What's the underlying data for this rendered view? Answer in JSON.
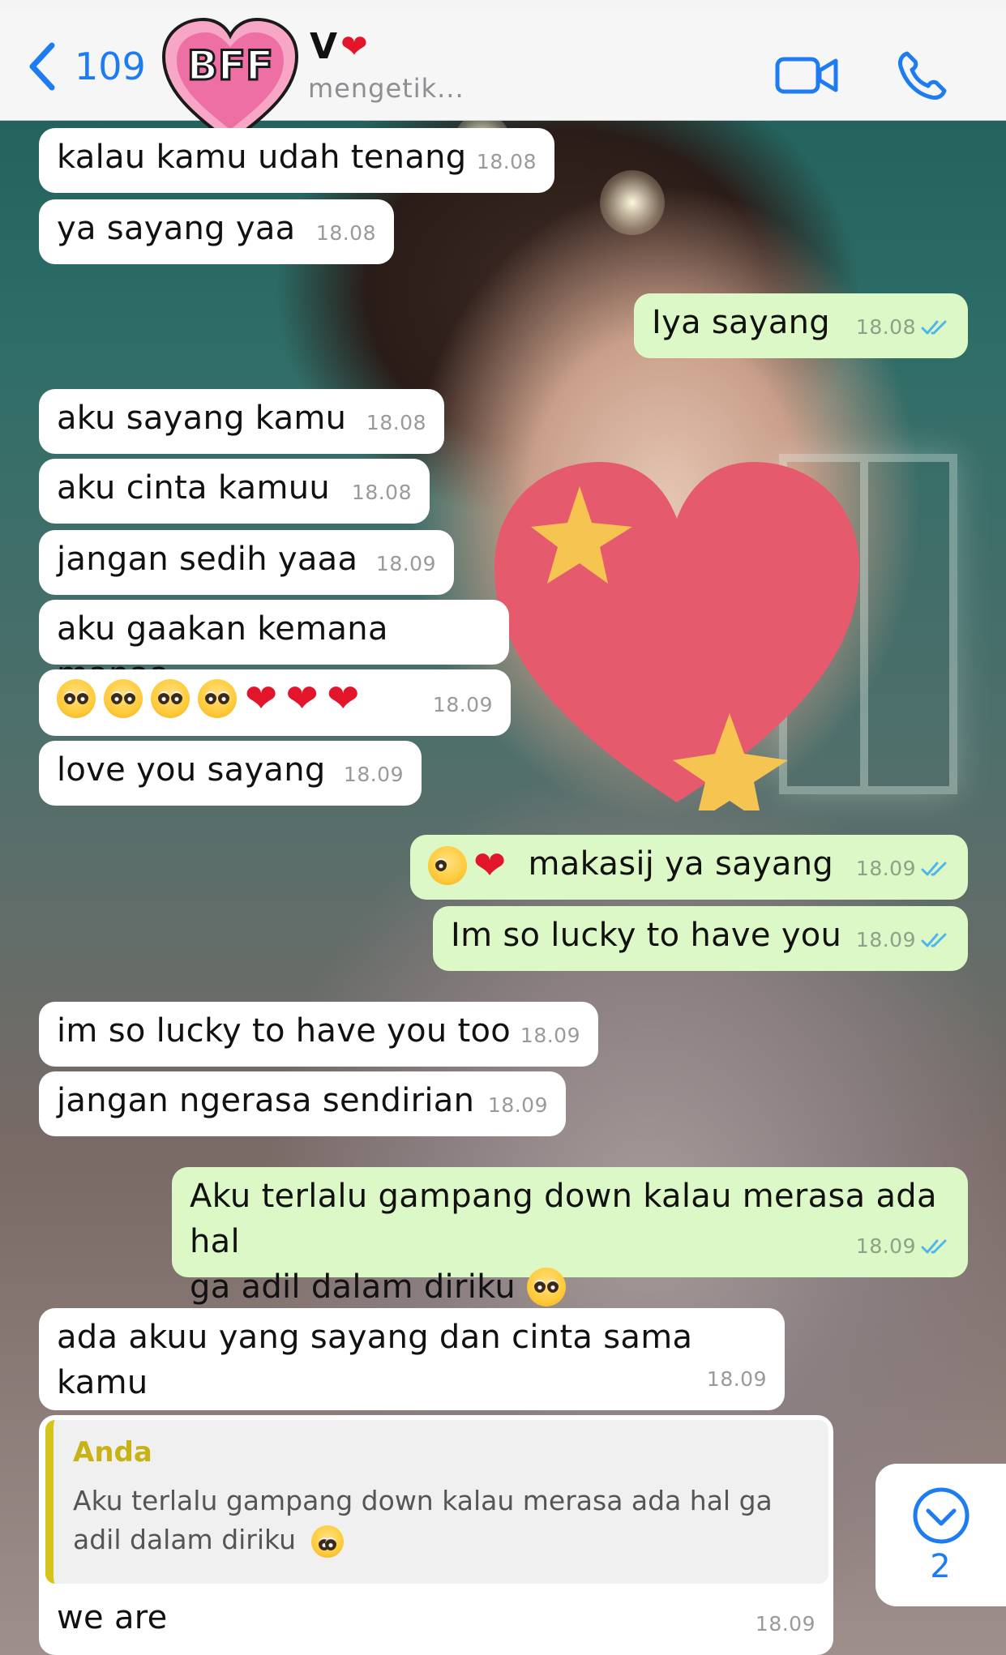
{
  "header": {
    "back_count": "109",
    "avatar_label": "BFF",
    "contact_name": "V",
    "status": "mengetik..."
  },
  "messages": [
    {
      "text": "kalau kamu udah tenang",
      "time": "18.08",
      "dir": "in"
    },
    {
      "text": "ya sayang yaa",
      "time": "18.08",
      "dir": "in"
    },
    {
      "text": "Iya sayang",
      "time": "18.08",
      "dir": "out"
    },
    {
      "text": "aku sayang kamu",
      "time": "18.08",
      "dir": "in"
    },
    {
      "text": "aku cinta kamuu",
      "time": "18.08",
      "dir": "in"
    },
    {
      "text": "jangan sedih yaaa",
      "time": "18.09",
      "dir": "in"
    },
    {
      "text": "aku gaakan kemana manaa",
      "time": "",
      "dir": "in"
    },
    {
      "text": "",
      "time": "18.09",
      "dir": "in"
    },
    {
      "text": "love you sayang",
      "time": "18.09",
      "dir": "in"
    },
    {
      "text": "makasij ya sayang",
      "time": "18.09",
      "dir": "out"
    },
    {
      "text": "Im so lucky to have you",
      "time": "18.09",
      "dir": "out"
    },
    {
      "text": "im so lucky to have you too",
      "time": "18.09",
      "dir": "in"
    },
    {
      "text": "jangan ngerasa sendirian",
      "time": "18.09",
      "dir": "in"
    },
    {
      "text_line1": "Aku terlalu gampang down kalau merasa ada hal",
      "text_line2": "ga adil dalam diriku",
      "time": "18.09",
      "dir": "out"
    },
    {
      "text": "ada akuu yang sayang dan cinta sama kamu",
      "time": "18.09",
      "dir": "in"
    },
    {
      "text": "we are",
      "time": "18.09",
      "dir": "in"
    }
  ],
  "quote": {
    "author": "Anda",
    "text": "Aku terlalu gampang down kalau merasa ada hal ga adil dalam diriku"
  },
  "scroll_button": {
    "count": "2"
  },
  "colors": {
    "accent": "#1e7cf2",
    "outgoing_bubble": "#dcf8c6",
    "incoming_bubble": "#ffffff",
    "quote_bar": "#d6c41b",
    "read_ticks": "#4fb6ec"
  },
  "icons": [
    "chevron-left-icon",
    "video-icon",
    "phone-icon",
    "double-check-icon",
    "chevron-down-circle-icon",
    "heart-emoji-icon",
    "pleading-face-emoji-icon",
    "crying-face-emoji-icon"
  ]
}
